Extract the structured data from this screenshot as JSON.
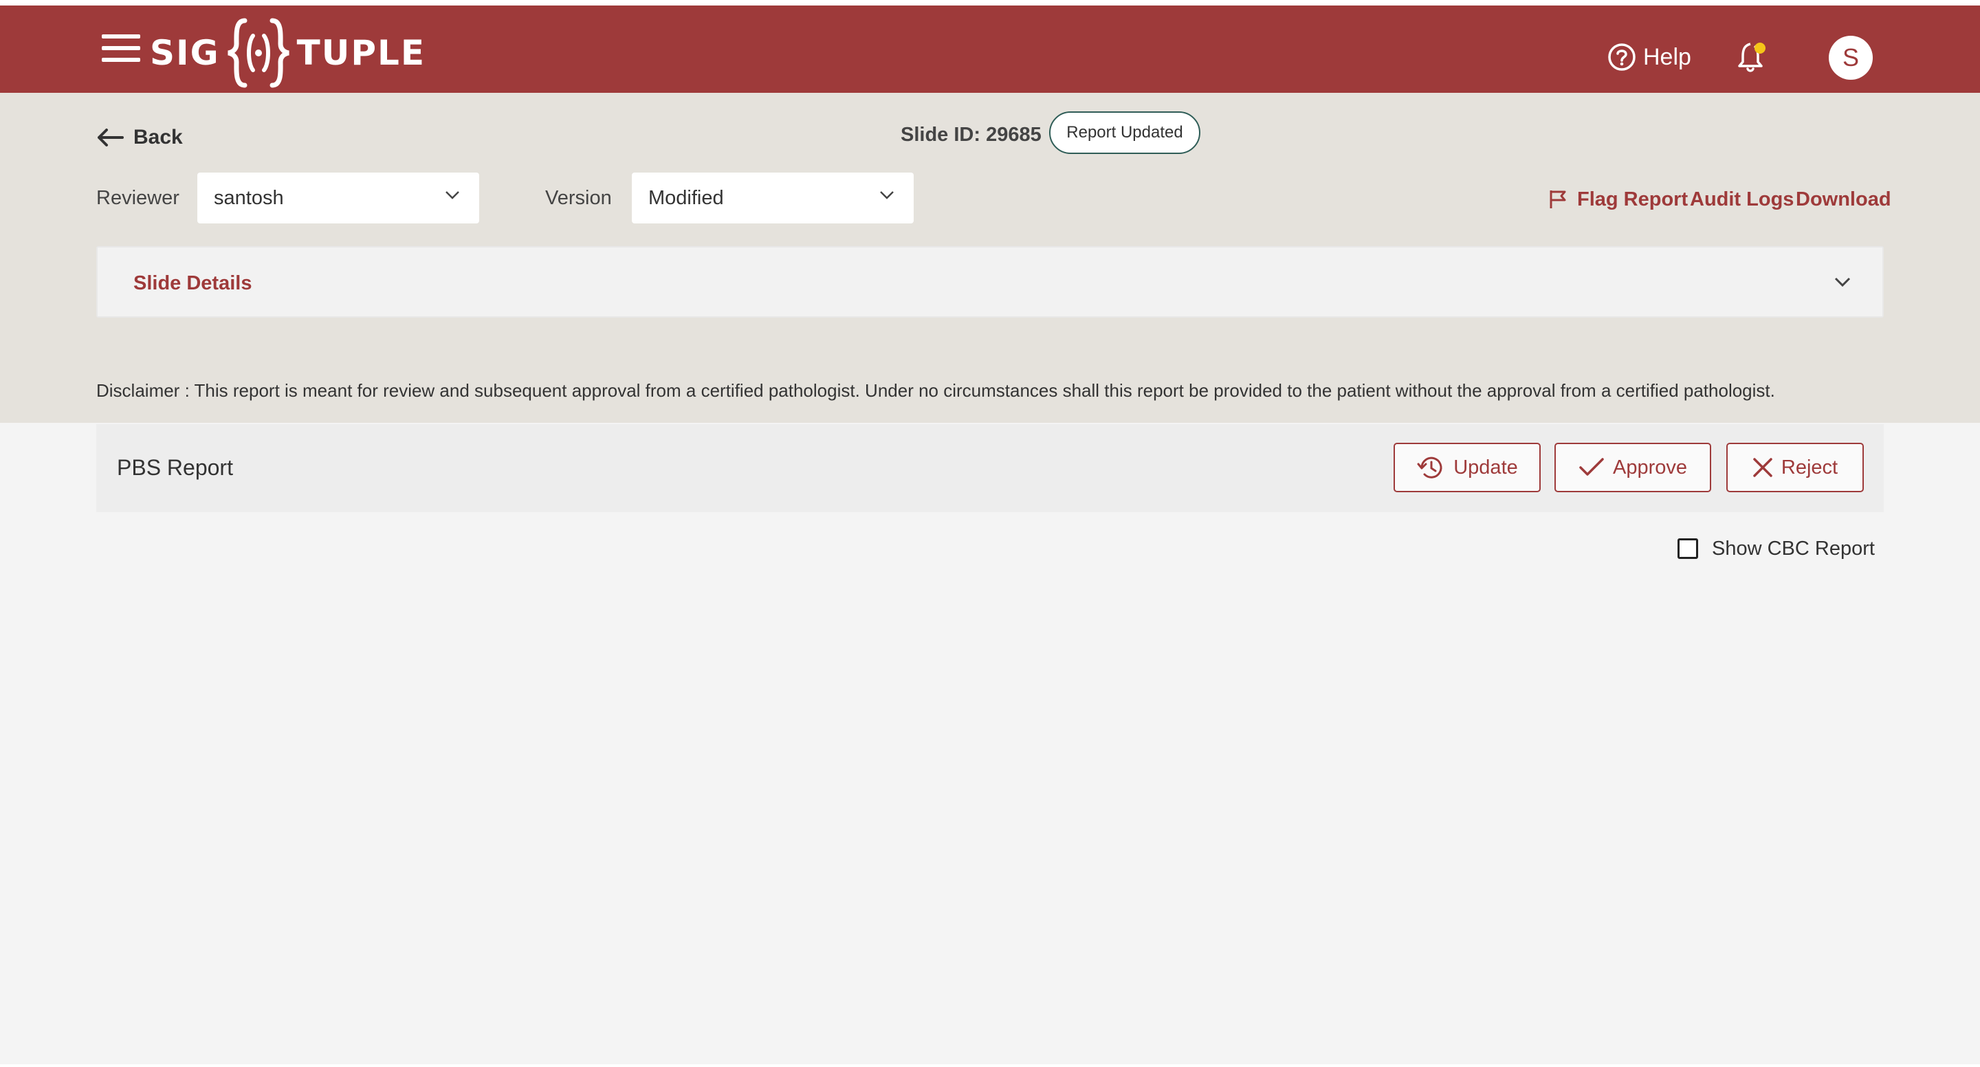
{
  "header": {
    "logo_left": "SIG",
    "logo_right": "TUPLE",
    "help_label": "Help",
    "avatar_initial": "S",
    "brand_color": "#9e3a3a",
    "notification_dot_color": "#f5c518"
  },
  "nav": {
    "back_label": "Back"
  },
  "slide": {
    "id_label": "Slide ID: 29685",
    "status": "Report Updated"
  },
  "filters": {
    "reviewer_label": "Reviewer",
    "reviewer_value": "santosh",
    "version_label": "Version",
    "version_value": "Modified"
  },
  "actions": {
    "flag_report": "Flag Report",
    "audit_logs": "Audit Logs",
    "download": "Download"
  },
  "slide_details": {
    "title": "Slide Details"
  },
  "disclaimer": "Disclaimer :  This report is meant for review and subsequent approval from a certified pathologist. Under no circumstances shall this report be provided to the patient without the approval from a certified pathologist.",
  "report": {
    "title": "PBS Report",
    "update_label": "Update",
    "approve_label": "Approve",
    "reject_label": "Reject"
  },
  "cbc": {
    "label": "Show CBC Report",
    "checked": false
  }
}
